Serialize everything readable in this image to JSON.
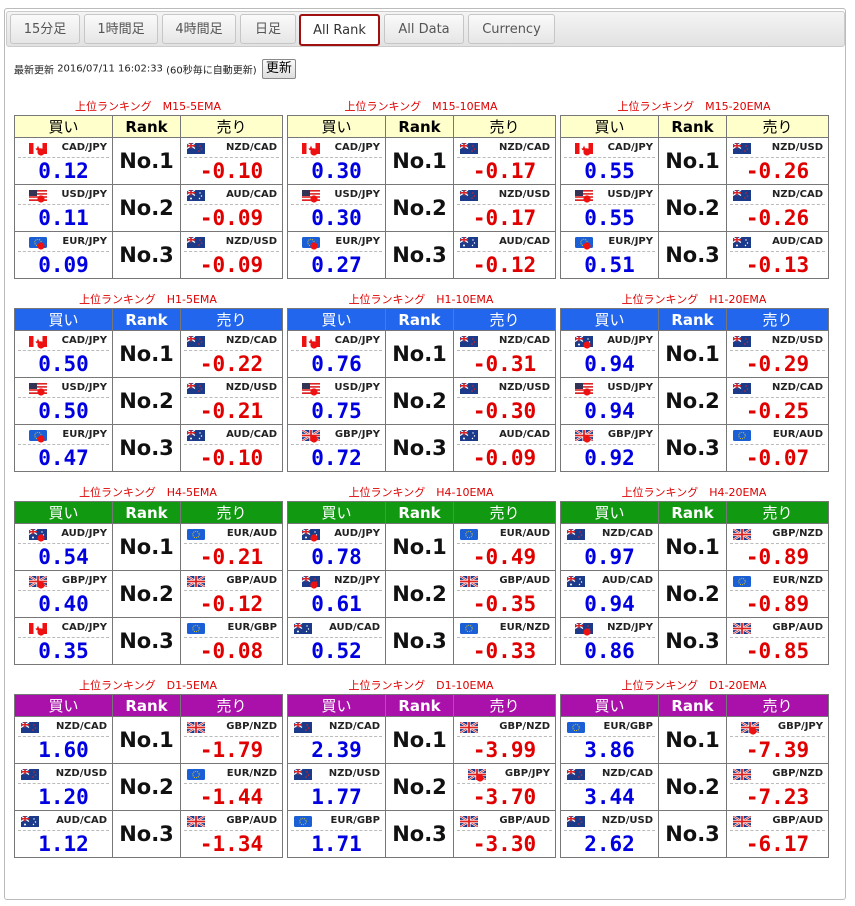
{
  "tabs": [
    {
      "label": "15分足"
    },
    {
      "label": "1時間足"
    },
    {
      "label": "4時間足"
    },
    {
      "label": "日足"
    },
    {
      "label": "All Rank",
      "active": true
    },
    {
      "label": "All Data"
    },
    {
      "label": "Currency"
    }
  ],
  "update": {
    "label": "最新更新",
    "timestamp": "2016/07/11 16:02:33",
    "note": "(60秒毎に自動更新)",
    "button": "更新"
  },
  "header_labels": {
    "buy": "買い",
    "rank": "Rank",
    "sell": "売り"
  },
  "rank_labels": [
    "No.1",
    "No.2",
    "No.3"
  ],
  "colors": {
    "M15": "#ffffcc",
    "H1": "#2266ee",
    "H4": "#119911",
    "D1": "#aa10aa",
    "buy_value": "#0000e0",
    "sell_value": "#e00000",
    "title": "#dd0000"
  },
  "groups": [
    {
      "timeframe": "M15",
      "header_text_color": "#000000",
      "panels": [
        {
          "title": "上位ランキング　M15-5EMA",
          "rows": [
            {
              "buy_pair": "CAD/JPY",
              "buy_flag": "CA",
              "buy_value": "0.12",
              "sell_pair": "NZD/CAD",
              "sell_flag": "NZ",
              "sell_value": "-0.10"
            },
            {
              "buy_pair": "USD/JPY",
              "buy_flag": "US",
              "buy_value": "0.11",
              "sell_pair": "AUD/CAD",
              "sell_flag": "AU",
              "sell_value": "-0.09"
            },
            {
              "buy_pair": "EUR/JPY",
              "buy_flag": "EU",
              "buy_value": "0.09",
              "sell_pair": "NZD/USD",
              "sell_flag": "NZ",
              "sell_value": "-0.09"
            }
          ]
        },
        {
          "title": "上位ランキング　M15-10EMA",
          "rows": [
            {
              "buy_pair": "CAD/JPY",
              "buy_flag": "CA",
              "buy_value": "0.30",
              "sell_pair": "NZD/CAD",
              "sell_flag": "NZ",
              "sell_value": "-0.17"
            },
            {
              "buy_pair": "USD/JPY",
              "buy_flag": "US",
              "buy_value": "0.30",
              "sell_pair": "NZD/USD",
              "sell_flag": "NZ",
              "sell_value": "-0.17"
            },
            {
              "buy_pair": "EUR/JPY",
              "buy_flag": "EU",
              "buy_value": "0.27",
              "sell_pair": "AUD/CAD",
              "sell_flag": "AU",
              "sell_value": "-0.12"
            }
          ]
        },
        {
          "title": "上位ランキング　M15-20EMA",
          "rows": [
            {
              "buy_pair": "CAD/JPY",
              "buy_flag": "CA",
              "buy_value": "0.55",
              "sell_pair": "NZD/USD",
              "sell_flag": "NZ",
              "sell_value": "-0.26"
            },
            {
              "buy_pair": "USD/JPY",
              "buy_flag": "US",
              "buy_value": "0.55",
              "sell_pair": "NZD/CAD",
              "sell_flag": "NZ",
              "sell_value": "-0.26"
            },
            {
              "buy_pair": "EUR/JPY",
              "buy_flag": "EU",
              "buy_value": "0.51",
              "sell_pair": "AUD/CAD",
              "sell_flag": "AU",
              "sell_value": "-0.13"
            }
          ]
        }
      ]
    },
    {
      "timeframe": "H1",
      "header_text_color": "#ffffff",
      "panels": [
        {
          "title": "上位ランキング　H1-5EMA",
          "rows": [
            {
              "buy_pair": "CAD/JPY",
              "buy_flag": "CA",
              "buy_value": "0.50",
              "sell_pair": "NZD/CAD",
              "sell_flag": "NZ",
              "sell_value": "-0.22"
            },
            {
              "buy_pair": "USD/JPY",
              "buy_flag": "US",
              "buy_value": "0.50",
              "sell_pair": "NZD/USD",
              "sell_flag": "NZ",
              "sell_value": "-0.21"
            },
            {
              "buy_pair": "EUR/JPY",
              "buy_flag": "EU",
              "buy_value": "0.47",
              "sell_pair": "AUD/CAD",
              "sell_flag": "AU",
              "sell_value": "-0.10"
            }
          ]
        },
        {
          "title": "上位ランキング　H1-10EMA",
          "rows": [
            {
              "buy_pair": "CAD/JPY",
              "buy_flag": "CA",
              "buy_value": "0.76",
              "sell_pair": "NZD/CAD",
              "sell_flag": "NZ",
              "sell_value": "-0.31"
            },
            {
              "buy_pair": "USD/JPY",
              "buy_flag": "US",
              "buy_value": "0.75",
              "sell_pair": "NZD/USD",
              "sell_flag": "NZ",
              "sell_value": "-0.30"
            },
            {
              "buy_pair": "GBP/JPY",
              "buy_flag": "GB",
              "buy_value": "0.72",
              "sell_pair": "AUD/CAD",
              "sell_flag": "AU",
              "sell_value": "-0.09"
            }
          ]
        },
        {
          "title": "上位ランキング　H1-20EMA",
          "rows": [
            {
              "buy_pair": "AUD/JPY",
              "buy_flag": "AU",
              "buy_value": "0.94",
              "sell_pair": "NZD/USD",
              "sell_flag": "NZ",
              "sell_value": "-0.29"
            },
            {
              "buy_pair": "USD/JPY",
              "buy_flag": "US",
              "buy_value": "0.94",
              "sell_pair": "NZD/CAD",
              "sell_flag": "NZ",
              "sell_value": "-0.25"
            },
            {
              "buy_pair": "GBP/JPY",
              "buy_flag": "GB",
              "buy_value": "0.92",
              "sell_pair": "EUR/AUD",
              "sell_flag": "EU",
              "sell_value": "-0.07"
            }
          ]
        }
      ]
    },
    {
      "timeframe": "H4",
      "header_text_color": "#ffffff",
      "panels": [
        {
          "title": "上位ランキング　H4-5EMA",
          "rows": [
            {
              "buy_pair": "AUD/JPY",
              "buy_flag": "AU",
              "buy_value": "0.54",
              "sell_pair": "EUR/AUD",
              "sell_flag": "EU",
              "sell_value": "-0.21"
            },
            {
              "buy_pair": "GBP/JPY",
              "buy_flag": "GB",
              "buy_value": "0.40",
              "sell_pair": "GBP/AUD",
              "sell_flag": "GB",
              "sell_value": "-0.12"
            },
            {
              "buy_pair": "CAD/JPY",
              "buy_flag": "CA",
              "buy_value": "0.35",
              "sell_pair": "EUR/GBP",
              "sell_flag": "EU",
              "sell_value": "-0.08"
            }
          ]
        },
        {
          "title": "上位ランキング　H4-10EMA",
          "rows": [
            {
              "buy_pair": "AUD/JPY",
              "buy_flag": "AU",
              "buy_value": "0.78",
              "sell_pair": "EUR/AUD",
              "sell_flag": "EU",
              "sell_value": "-0.49"
            },
            {
              "buy_pair": "NZD/JPY",
              "buy_flag": "NZ",
              "buy_value": "0.61",
              "sell_pair": "GBP/AUD",
              "sell_flag": "GB",
              "sell_value": "-0.35"
            },
            {
              "buy_pair": "AUD/CAD",
              "buy_flag": "AU",
              "buy_value": "0.52",
              "sell_pair": "EUR/NZD",
              "sell_flag": "EU",
              "sell_value": "-0.33"
            }
          ]
        },
        {
          "title": "上位ランキング　H4-20EMA",
          "rows": [
            {
              "buy_pair": "NZD/CAD",
              "buy_flag": "NZ",
              "buy_value": "0.97",
              "sell_pair": "GBP/NZD",
              "sell_flag": "GB",
              "sell_value": "-0.89"
            },
            {
              "buy_pair": "AUD/CAD",
              "buy_flag": "AU",
              "buy_value": "0.94",
              "sell_pair": "EUR/NZD",
              "sell_flag": "EU",
              "sell_value": "-0.89"
            },
            {
              "buy_pair": "NZD/JPY",
              "buy_flag": "NZ",
              "buy_value": "0.86",
              "sell_pair": "GBP/AUD",
              "sell_flag": "GB",
              "sell_value": "-0.85"
            }
          ]
        }
      ]
    },
    {
      "timeframe": "D1",
      "header_text_color": "#ffffff",
      "panels": [
        {
          "title": "上位ランキング　D1-5EMA",
          "rows": [
            {
              "buy_pair": "NZD/CAD",
              "buy_flag": "NZ",
              "buy_value": "1.60",
              "sell_pair": "GBP/NZD",
              "sell_flag": "GB",
              "sell_value": "-1.79"
            },
            {
              "buy_pair": "NZD/USD",
              "buy_flag": "NZ",
              "buy_value": "1.20",
              "sell_pair": "EUR/NZD",
              "sell_flag": "EU",
              "sell_value": "-1.44"
            },
            {
              "buy_pair": "AUD/CAD",
              "buy_flag": "AU",
              "buy_value": "1.12",
              "sell_pair": "GBP/AUD",
              "sell_flag": "GB",
              "sell_value": "-1.34"
            }
          ]
        },
        {
          "title": "上位ランキング　D1-10EMA",
          "rows": [
            {
              "buy_pair": "NZD/CAD",
              "buy_flag": "NZ",
              "buy_value": "2.39",
              "sell_pair": "GBP/NZD",
              "sell_flag": "GB",
              "sell_value": "-3.99"
            },
            {
              "buy_pair": "NZD/USD",
              "buy_flag": "NZ",
              "buy_value": "1.77",
              "sell_pair": "GBP/JPY",
              "sell_flag": "GB",
              "sell_value": "-3.70"
            },
            {
              "buy_pair": "EUR/GBP",
              "buy_flag": "EU",
              "buy_value": "1.71",
              "sell_pair": "GBP/AUD",
              "sell_flag": "GB",
              "sell_value": "-3.30"
            }
          ]
        },
        {
          "title": "上位ランキング　D1-20EMA",
          "rows": [
            {
              "buy_pair": "EUR/GBP",
              "buy_flag": "EU",
              "buy_value": "3.86",
              "sell_pair": "GBP/JPY",
              "sell_flag": "GB",
              "sell_value": "-7.39"
            },
            {
              "buy_pair": "NZD/CAD",
              "buy_flag": "NZ",
              "buy_value": "3.44",
              "sell_pair": "GBP/NZD",
              "sell_flag": "GB",
              "sell_value": "-7.23"
            },
            {
              "buy_pair": "NZD/USD",
              "buy_flag": "NZ",
              "buy_value": "2.62",
              "sell_pair": "GBP/AUD",
              "sell_flag": "GB",
              "sell_value": "-6.17"
            }
          ]
        }
      ]
    }
  ]
}
